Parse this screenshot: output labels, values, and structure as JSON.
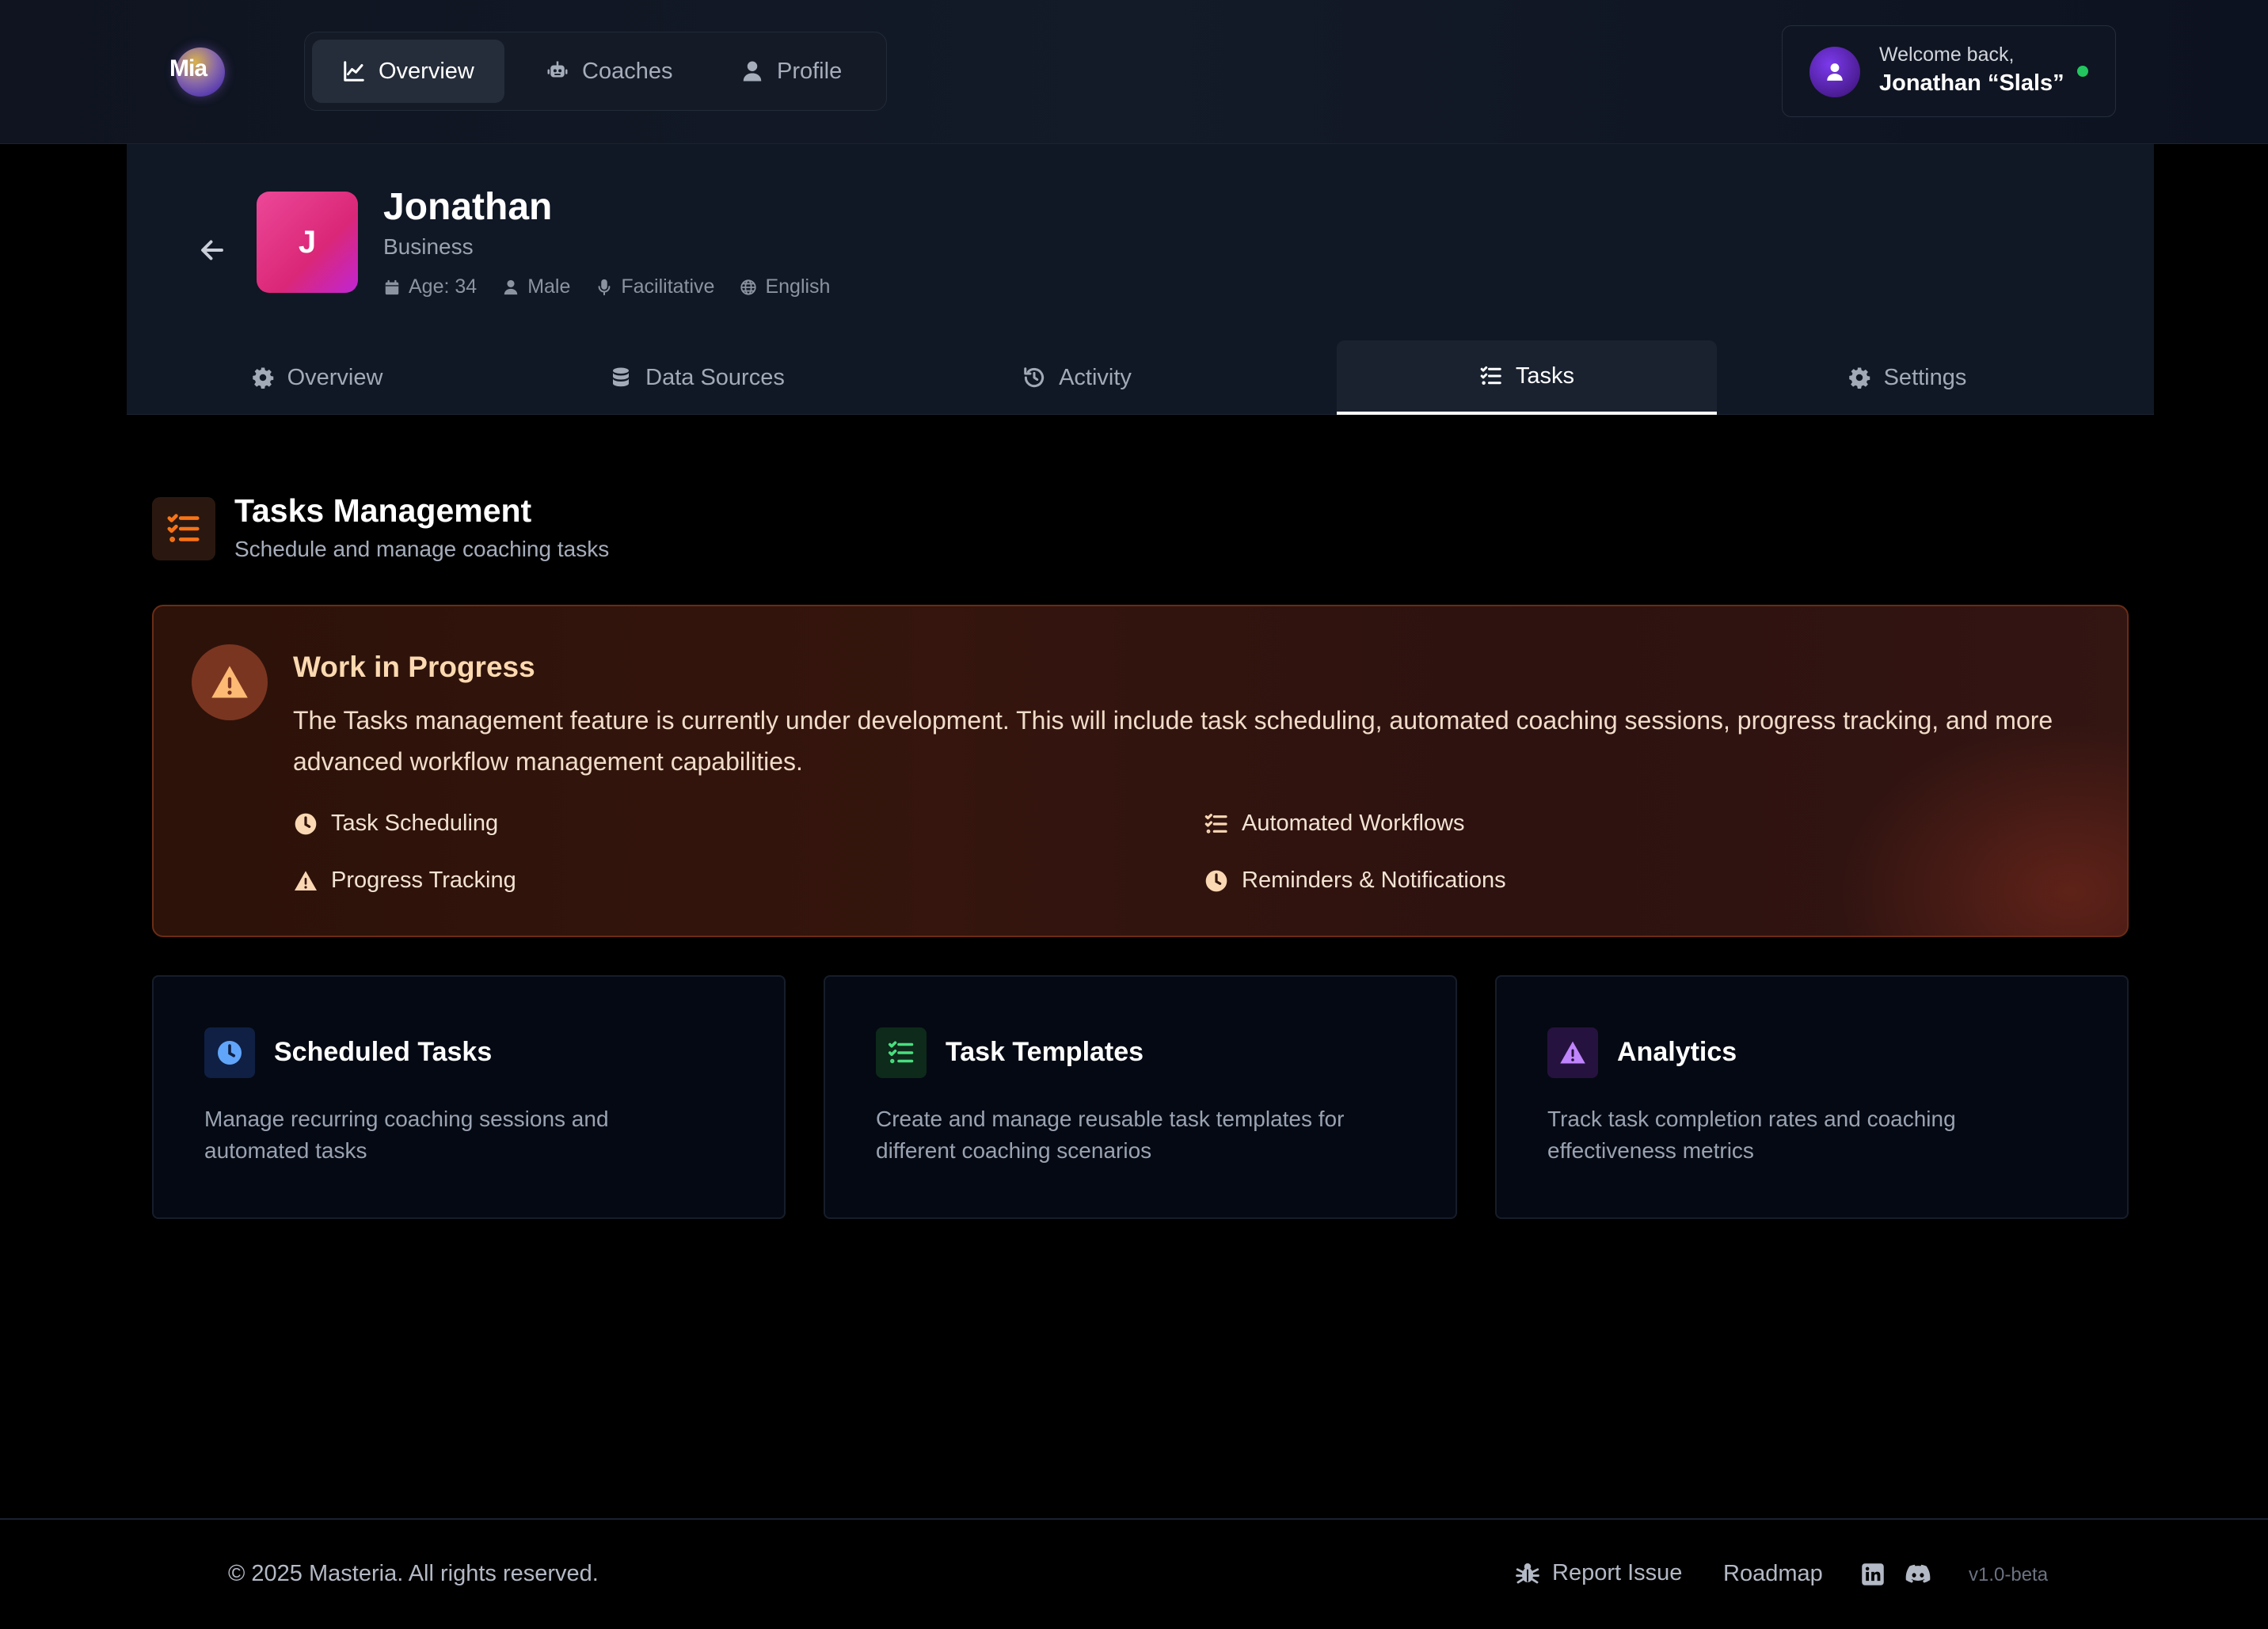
{
  "app": {
    "logo_text": "Mia"
  },
  "topnav": {
    "items": [
      {
        "label": "Overview",
        "icon": "chart-line-icon",
        "active": true
      },
      {
        "label": "Coaches",
        "icon": "robot-icon",
        "active": false
      },
      {
        "label": "Profile",
        "icon": "user-icon",
        "active": false
      }
    ]
  },
  "user": {
    "greeting": "Welcome back,",
    "name": "Jonathan “Slals”",
    "status": "online",
    "status_color": "#22c55e"
  },
  "profile": {
    "initial": "J",
    "name": "Jonathan",
    "role": "Business",
    "meta": {
      "age": "Age: 34",
      "gender": "Male",
      "style": "Facilitative",
      "language": "English"
    },
    "avatar_color": "#ec4899"
  },
  "tabs": [
    {
      "label": "Overview",
      "icon": "gear-icon",
      "active": false
    },
    {
      "label": "Data Sources",
      "icon": "database-icon",
      "active": false
    },
    {
      "label": "Activity",
      "icon": "history-icon",
      "active": false
    },
    {
      "label": "Tasks",
      "icon": "task-list-icon",
      "active": true
    },
    {
      "label": "Settings",
      "icon": "gear-icon",
      "active": false
    }
  ],
  "section": {
    "title": "Tasks Management",
    "subtitle": "Schedule and manage coaching tasks",
    "accent": "#f97316"
  },
  "wip": {
    "title": "Work in Progress",
    "text": "The Tasks management feature is currently under development. This will include task scheduling, automated coaching sessions, progress tracking, and more advanced workflow management capabilities.",
    "features": [
      {
        "label": "Task Scheduling",
        "icon": "clock-icon"
      },
      {
        "label": "Automated Workflows",
        "icon": "task-list-icon"
      },
      {
        "label": "Progress Tracking",
        "icon": "warning-icon"
      },
      {
        "label": "Reminders & Notifications",
        "icon": "clock-icon"
      }
    ]
  },
  "cards": [
    {
      "title": "Scheduled Tasks",
      "description": "Manage recurring coaching sessions and automated tasks",
      "icon": "clock-icon",
      "color": "#3b82f6"
    },
    {
      "title": "Task Templates",
      "description": "Create and manage reusable task templates for different coaching scenarios",
      "icon": "task-list-icon",
      "color": "#22c55e"
    },
    {
      "title": "Analytics",
      "description": "Track task completion rates and coaching effectiveness metrics",
      "icon": "warning-icon",
      "color": "#a855f7"
    }
  ],
  "footer": {
    "copyright": "© 2025 Masteria. All rights reserved.",
    "report_issue": "Report Issue",
    "roadmap": "Roadmap",
    "version": "v1.0-beta",
    "social": [
      "linkedin-icon",
      "discord-icon"
    ]
  }
}
